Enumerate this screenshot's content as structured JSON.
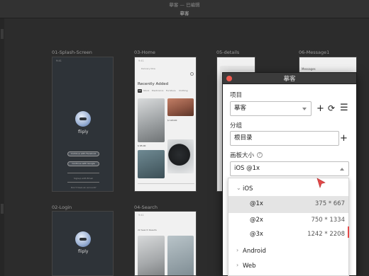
{
  "window": {
    "title": "摹客 — 已编辑",
    "file_title": "摹客"
  },
  "artboards": [
    {
      "label": "01-Splash-Screen"
    },
    {
      "label": "03-Home"
    },
    {
      "label": "05-details"
    },
    {
      "label": "06-Message1"
    },
    {
      "label": "02-Login"
    },
    {
      "label": "04-Search"
    }
  ],
  "splash": {
    "status_time": "9:41",
    "app_name": "fliply",
    "facebook_btn": "Continue with Facebook",
    "google_btn": "Continue with Google",
    "email_btn": "Signup with Email",
    "no_account": "Don't have an account?"
  },
  "home": {
    "status_time": "9:41",
    "location": "Delivery Now",
    "recently_added": "Recently Added",
    "tabs": [
      "All",
      "Stock",
      "Electronics",
      "Furniture",
      "Clothing"
    ],
    "price_1": "$ 120.00",
    "price_2": "$ 65.00"
  },
  "search": {
    "status_time": "9:41",
    "result_text": "22 Search Results"
  },
  "message": {
    "header": "Messages"
  },
  "login": {
    "app_name": "fliply"
  },
  "popup": {
    "title": "摹客",
    "project_label": "项目",
    "project_value": "摹客",
    "group_label": "分组",
    "group_value": "根目录",
    "size_label": "画板大小",
    "help_symbol": "?",
    "size_value": "iOS @1x"
  },
  "dropdown": {
    "group_ios": "iOS",
    "options": [
      {
        "name": "@1x",
        "size": "375 * 667"
      },
      {
        "name": "@2x",
        "size": "750 * 1334"
      },
      {
        "name": "@3x",
        "size": "1242 * 2208"
      }
    ],
    "group_android": "Android",
    "group_web": "Web"
  },
  "colors": {
    "close": "#ef5a4f",
    "cursor": "#e34848",
    "canvas": "#2c2c2c"
  }
}
